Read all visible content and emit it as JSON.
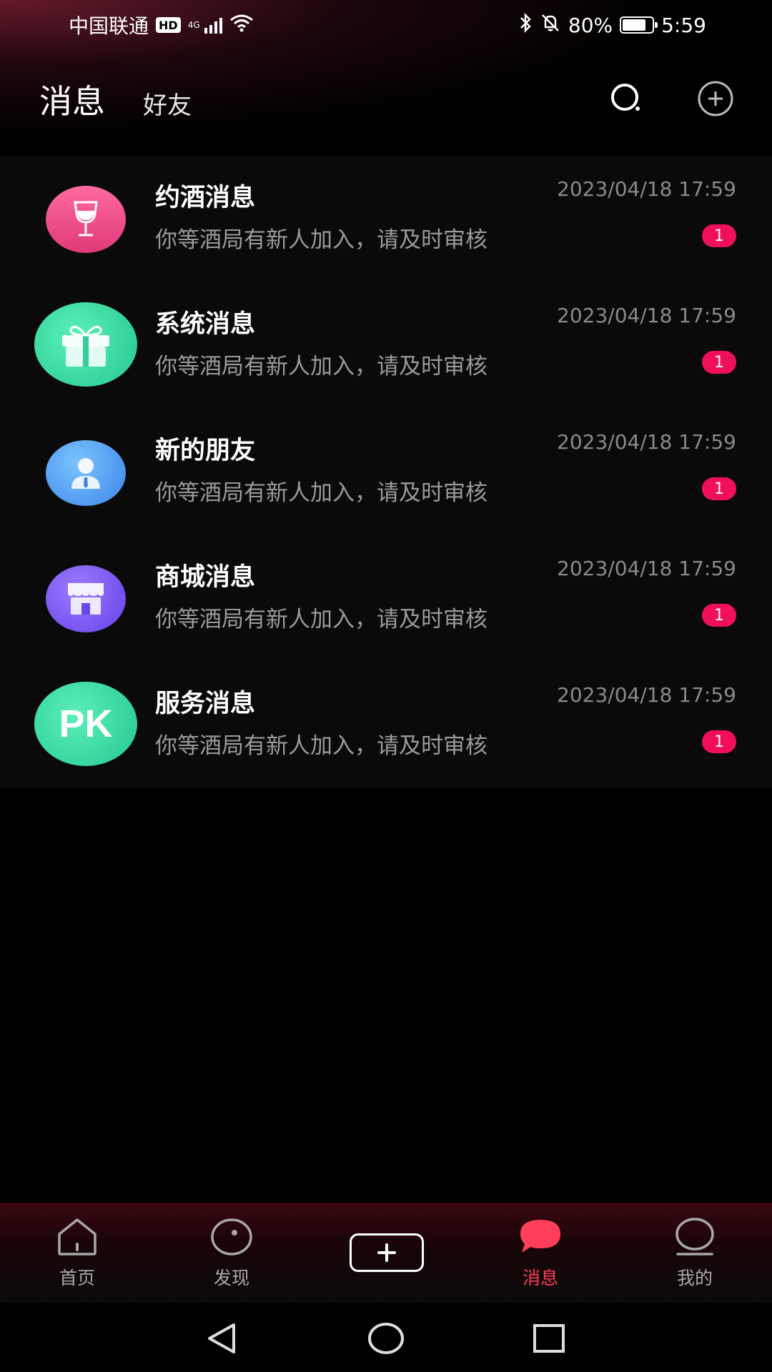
{
  "status_bar": {
    "carrier": "中国联通",
    "hd": "HD",
    "network": "4G",
    "battery_percent": "80%",
    "battery_level": 0.8,
    "time": "5:59"
  },
  "header": {
    "tab_active": "消息",
    "tab_inactive": "好友",
    "search_icon": "search-icon",
    "add_icon": "plus-circle-icon"
  },
  "messages": [
    {
      "title": "约酒消息",
      "time": "2023/04/18 17:59",
      "preview": "你等酒局有新人加入，请及时审核",
      "badge": "1",
      "icon": "wine-glass-icon",
      "color": "#ee4d8a"
    },
    {
      "title": "系统消息",
      "time": "2023/04/18 17:59",
      "preview": "你等酒局有新人加入，请及时审核",
      "badge": "1",
      "icon": "gift-icon",
      "color": "#34e0a0"
    },
    {
      "title": "新的朋友",
      "time": "2023/04/18 17:59",
      "preview": "你等酒局有新人加入，请及时审核",
      "badge": "1",
      "icon": "person-icon",
      "color": "#4a9cf0"
    },
    {
      "title": "商城消息",
      "time": "2023/04/18 17:59",
      "preview": "你等酒局有新人加入，请及时审核",
      "badge": "1",
      "icon": "store-icon",
      "color": "#7a55f0"
    },
    {
      "title": "服务消息",
      "time": "2023/04/18 17:59",
      "preview": "你等酒局有新人加入，请及时审核",
      "badge": "1",
      "icon": "pk-icon",
      "color": "#38e0a8",
      "avatar_text": "PK"
    }
  ],
  "bottom_nav": {
    "items": [
      {
        "label": "首页",
        "icon": "home-icon"
      },
      {
        "label": "发现",
        "icon": "discover-icon"
      },
      {
        "label": "",
        "icon": "plus-box-icon"
      },
      {
        "label": "消息",
        "icon": "chat-bubble-icon"
      },
      {
        "label": "我的",
        "icon": "profile-icon"
      }
    ],
    "active_color": "#ff3e5a"
  },
  "system_nav": {
    "back": "back-icon",
    "home": "home-circle-icon",
    "recents": "recents-icon"
  }
}
